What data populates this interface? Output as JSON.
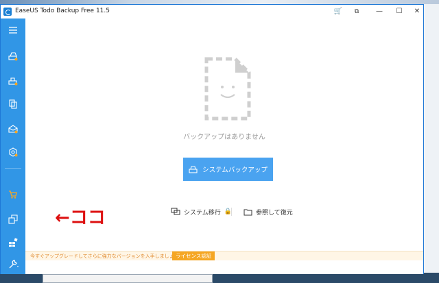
{
  "window": {
    "title": "EaseUS Todo Backup Free 11.5",
    "controls": {
      "cart": "🛒",
      "restore_dock": "⧉",
      "minimize": "—",
      "maximize": "☐",
      "close": "✕"
    }
  },
  "sidebar": {
    "items": [
      {
        "id": "menu",
        "icon": "hamburger-icon"
      },
      {
        "id": "disk-backup",
        "icon": "disk-backup-icon"
      },
      {
        "id": "system-backup",
        "icon": "system-backup-icon"
      },
      {
        "id": "file-backup",
        "icon": "file-backup-icon"
      },
      {
        "id": "mail-backup",
        "icon": "mail-backup-icon"
      },
      {
        "id": "smart-backup",
        "icon": "smart-backup-icon"
      },
      {
        "id": "upgrade-cart",
        "icon": "cart-icon"
      },
      {
        "id": "clone",
        "icon": "clone-icon"
      },
      {
        "id": "apps",
        "icon": "apps-icon"
      },
      {
        "id": "tools",
        "icon": "tools-icon"
      }
    ]
  },
  "main": {
    "empty_message": "バックアップはありません",
    "primary_button": "システムバックアップ",
    "links": {
      "system_transfer": "システム移行",
      "browse_restore": "参照して復元"
    }
  },
  "banner": {
    "text": "今すぐアップグレードしてさらに強力なバージョンを入手しましょう。",
    "license_button": "ライセンス認証"
  },
  "annotation": {
    "text": "←ココ"
  },
  "colors": {
    "sidebar": "#3196e6",
    "primary_button": "#4aa3f0",
    "accent_orange": "#f5a623",
    "annotation_red": "#dd1111"
  }
}
